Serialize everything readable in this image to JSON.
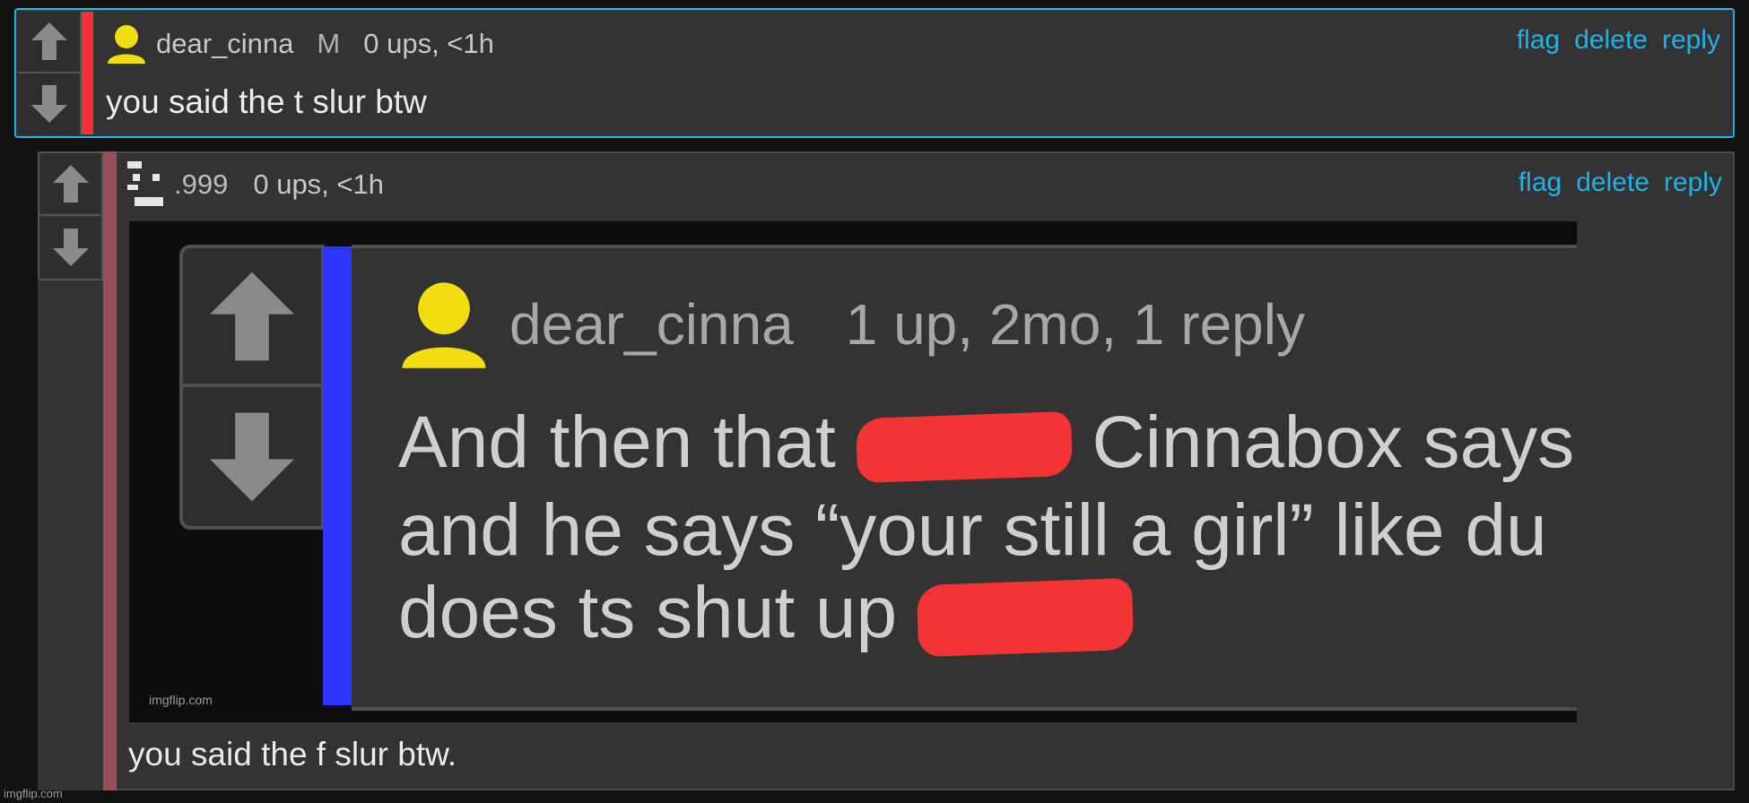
{
  "comments": [
    {
      "username": "dear_cinna",
      "gender": "M",
      "stats": "0 ups, <1h",
      "body": "you said the t slur btw",
      "avatar_icon": "user-avatar-icon",
      "accent_color": "#f33035"
    },
    {
      "username": ".999",
      "stats": "0 ups, <1h",
      "body": "you said the f slur btw.",
      "avatar_icon": "pixel-avatar-icon",
      "accent_color": "#9a4f56"
    }
  ],
  "actions": {
    "flag": "flag",
    "delete": "delete",
    "reply": "reply"
  },
  "embedded_image": {
    "username": "dear_cinna",
    "stats": "1 up, 2mo, 1 reply",
    "line1_before": "And then that",
    "line1_after": "Cinnabox says",
    "line2": "and he says “your still a girl” like du",
    "line3": "does ts shut up",
    "watermark": "imgflip.com",
    "accent_color": "#2e34ff"
  },
  "page_watermark": "imgflip.com",
  "colors": {
    "link": "#1fb1e8",
    "selected_border": "#1bb4e6",
    "redaction": "#f43434"
  }
}
